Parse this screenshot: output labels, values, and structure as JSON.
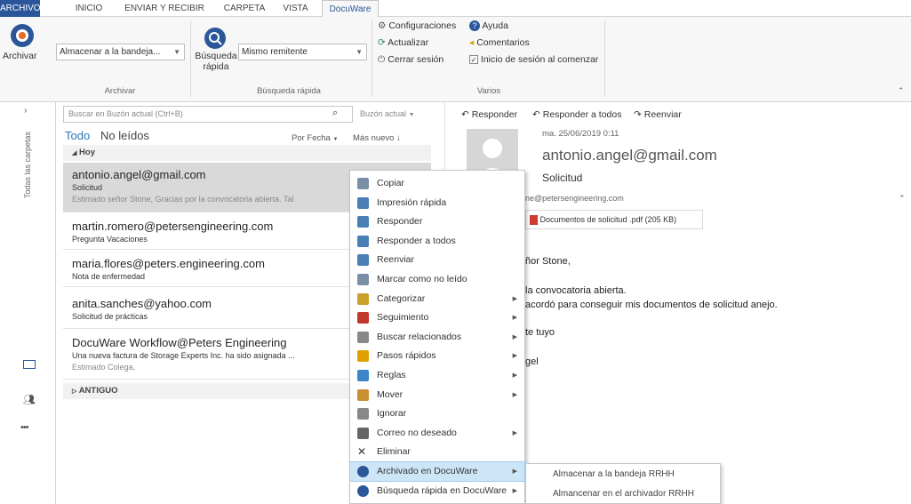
{
  "tabs": [
    "ARCHIVO",
    "INICIO",
    "ENVIAR Y RECIBIR",
    "CARPETA",
    "VISTA",
    "DocuWare"
  ],
  "ribbon": {
    "archivar_label": "Archivar",
    "store_combo": "Almacenar a la bandeja...",
    "archivar_group": "Archivar",
    "quick_search_label": "Búsqueda rápida",
    "search_combo": "Mismo remitente",
    "quick_search_group": "Búsqueda rápida",
    "config": "Configuraciones",
    "help": "Ayuda",
    "update": "Actualizar",
    "comments": "Comentarios",
    "logout": "Cerrar sesión",
    "login_start": "Inicio de sesión al comenzar",
    "varios_group": "Varios"
  },
  "nav": {
    "folders_label": "Todas las carpetas",
    "more": "•••"
  },
  "list": {
    "search_placeholder": "Buscar en Buzón actual (Ctrl+B)",
    "scope": "Buzón actual",
    "filter_all": "Todo",
    "filter_unread": "No leídos",
    "sort_by": "Por Fecha",
    "sort_order": "Más nuevo",
    "group_today": "Hoy",
    "group_old": "ANTIGUO",
    "messages": [
      {
        "from": "antonio.angel@gmail.com",
        "subject": "Solicitud",
        "preview": "Estimado señor Stone,  Gracias por la convocatoria abierta.  Tal"
      },
      {
        "from": "martin.romero@petersengineering.com",
        "subject": "Pregunta Vacaciones",
        "preview": ""
      },
      {
        "from": "maria.flores@peters.engineering.com",
        "subject": "Nota de enfermedad",
        "preview": ""
      },
      {
        "from": "anita.sanches@yahoo.com",
        "subject": "Solicitud de prácticas",
        "preview": ""
      },
      {
        "from": "DocuWare Workflow@Peters Engineering",
        "subject": "Una nueva factura de Storage Experts Inc. ha sido asignada ...",
        "preview": "Estimado Colega,"
      }
    ]
  },
  "reading": {
    "reply": "Responder",
    "reply_all": "Responder a todos",
    "forward": "Reenviar",
    "date": "ma. 25/06/2019 0:11",
    "sender": "antonio.angel@gmail.com",
    "subject": "Solicitud",
    "to": "ne@petersengineering.com",
    "attachment": "Documentos de solicitud .pdf (205 KB)",
    "body": [
      "ñor Stone,",
      "la convocatoria abierta.",
      "acordó para conseguir mis documentos de solicitud anejo.",
      "te tuyo",
      "gel"
    ]
  },
  "context_menu": [
    {
      "label": "Copiar",
      "icon": "copy-icon",
      "sub": false
    },
    {
      "label": "Impresión rápida",
      "icon": "print-icon",
      "sub": false
    },
    {
      "label": "Responder",
      "icon": "reply-icon",
      "sub": false
    },
    {
      "label": "Responder a todos",
      "icon": "reply-all-icon",
      "sub": false
    },
    {
      "label": "Reenviar",
      "icon": "forward-icon",
      "sub": false
    },
    {
      "label": "Marcar como no leído",
      "icon": "mark-unread-icon",
      "sub": false
    },
    {
      "label": "Categorizar",
      "icon": "categorize-icon",
      "sub": true
    },
    {
      "label": "Seguimiento",
      "icon": "flag-icon",
      "sub": true
    },
    {
      "label": "Buscar relacionados",
      "icon": "search-related-icon",
      "sub": true
    },
    {
      "label": "Pasos rápidos",
      "icon": "quick-steps-icon",
      "sub": true
    },
    {
      "label": "Reglas",
      "icon": "rules-icon",
      "sub": true
    },
    {
      "label": "Mover",
      "icon": "move-icon",
      "sub": true
    },
    {
      "label": "Ignorar",
      "icon": "ignore-icon",
      "sub": false
    },
    {
      "label": "Correo no deseado",
      "icon": "junk-icon",
      "sub": true
    },
    {
      "label": "Eliminar",
      "icon": "delete-icon",
      "sub": false
    },
    {
      "label": "Archivado en DocuWare",
      "icon": "docuware-archive-icon",
      "sub": true
    },
    {
      "label": "Búsqueda rápida en DocuWare",
      "icon": "docuware-search-icon",
      "sub": true
    }
  ],
  "submenu": [
    "Almacenar a la bandeja RRHH",
    "Almancenar en el archivador RRHH"
  ],
  "colors": {
    "accent": "#2b579a",
    "highlight": "#cde6f7",
    "link": "#2e75b6"
  }
}
